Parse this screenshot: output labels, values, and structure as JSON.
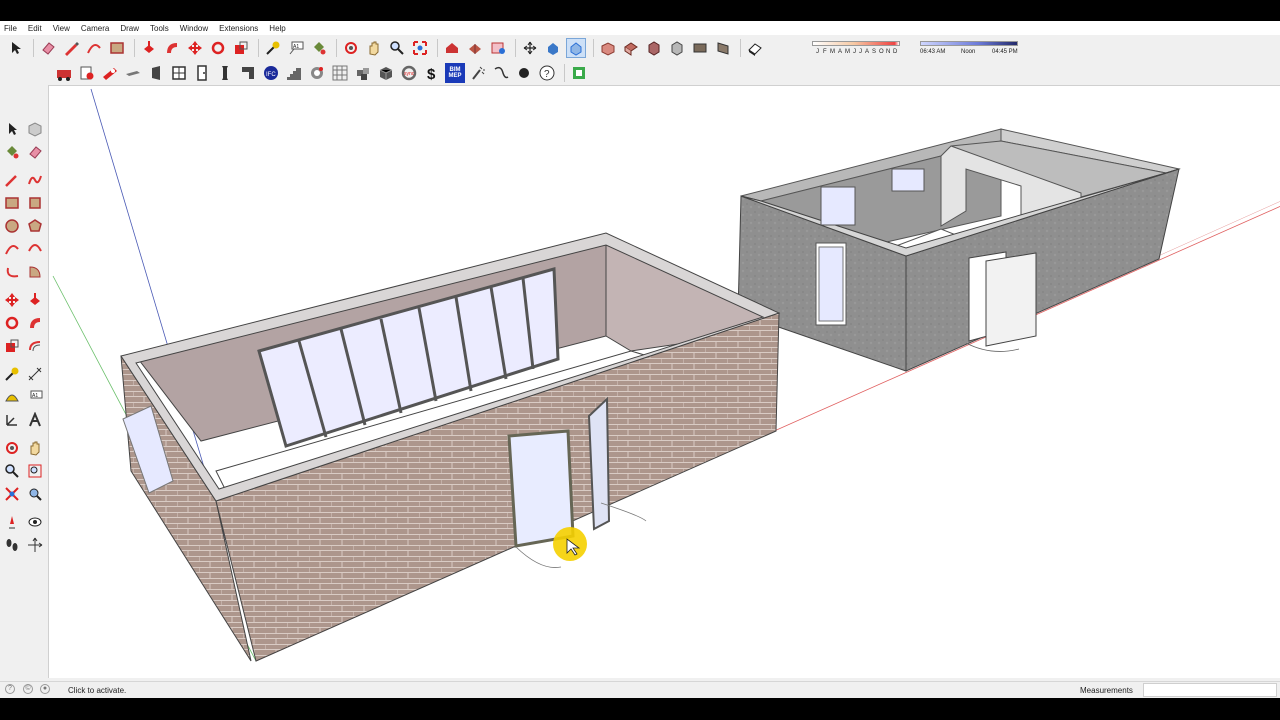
{
  "menu": [
    "File",
    "Edit",
    "View",
    "Camera",
    "Draw",
    "Tools",
    "Window",
    "Extensions",
    "Help"
  ],
  "shadows": {
    "months": [
      "J",
      "F",
      "M",
      "A",
      "M",
      "J",
      "J",
      "A",
      "S",
      "O",
      "N",
      "D"
    ],
    "time_start": "06:43 AM",
    "time_mid": "Noon",
    "time_end": "04:45 PM"
  },
  "toolbar_top_icons": [
    "select-icon",
    "eraser-icon",
    "pencil-line-icon",
    "arc-icon",
    "rectangle-icon",
    "push-pull-icon",
    "follow-me-icon",
    "move-icon",
    "rotate-icon",
    "scale-icon",
    "tape-measure-icon",
    "text-label-icon",
    "paint-bucket-icon",
    "orbit-icon",
    "pan-icon",
    "zoom-icon",
    "zoom-extents-icon",
    "warehouse-icon",
    "extension-warehouse-icon",
    "layout-icon",
    "axis-icon",
    "section-icon",
    "xray-icon",
    "iso-view-icon",
    "top-view-icon",
    "front-view-icon",
    "right-view-icon",
    "back-view-icon",
    "left-view-icon",
    "shadow-toggle-icon"
  ],
  "toolbar_second_icons": [
    "component-icon",
    "model-info-icon",
    "ruler-icon",
    "door-icon",
    "window-icon",
    "wall-icon",
    "column-icon",
    "beam-icon",
    "ifc-icon",
    "stair-icon",
    "gear-icon",
    "grid-icon",
    "block-icon",
    "cube-icon",
    "sync-icon",
    "dollar-icon",
    "bim-mep-icon",
    "wand-icon",
    "chain-icon",
    "dot-icon",
    "help-icon",
    "export-icon"
  ],
  "bim_label": "BIM\nMEP",
  "status": {
    "text": "Click to activate.",
    "measurements_label": "Measurements",
    "measurements_value": ""
  },
  "colors": {
    "accent_blue": "#2a6fd6",
    "brick": "#a89288",
    "wall_gray": "#8c8c8c",
    "highlight": "#f5d000"
  }
}
